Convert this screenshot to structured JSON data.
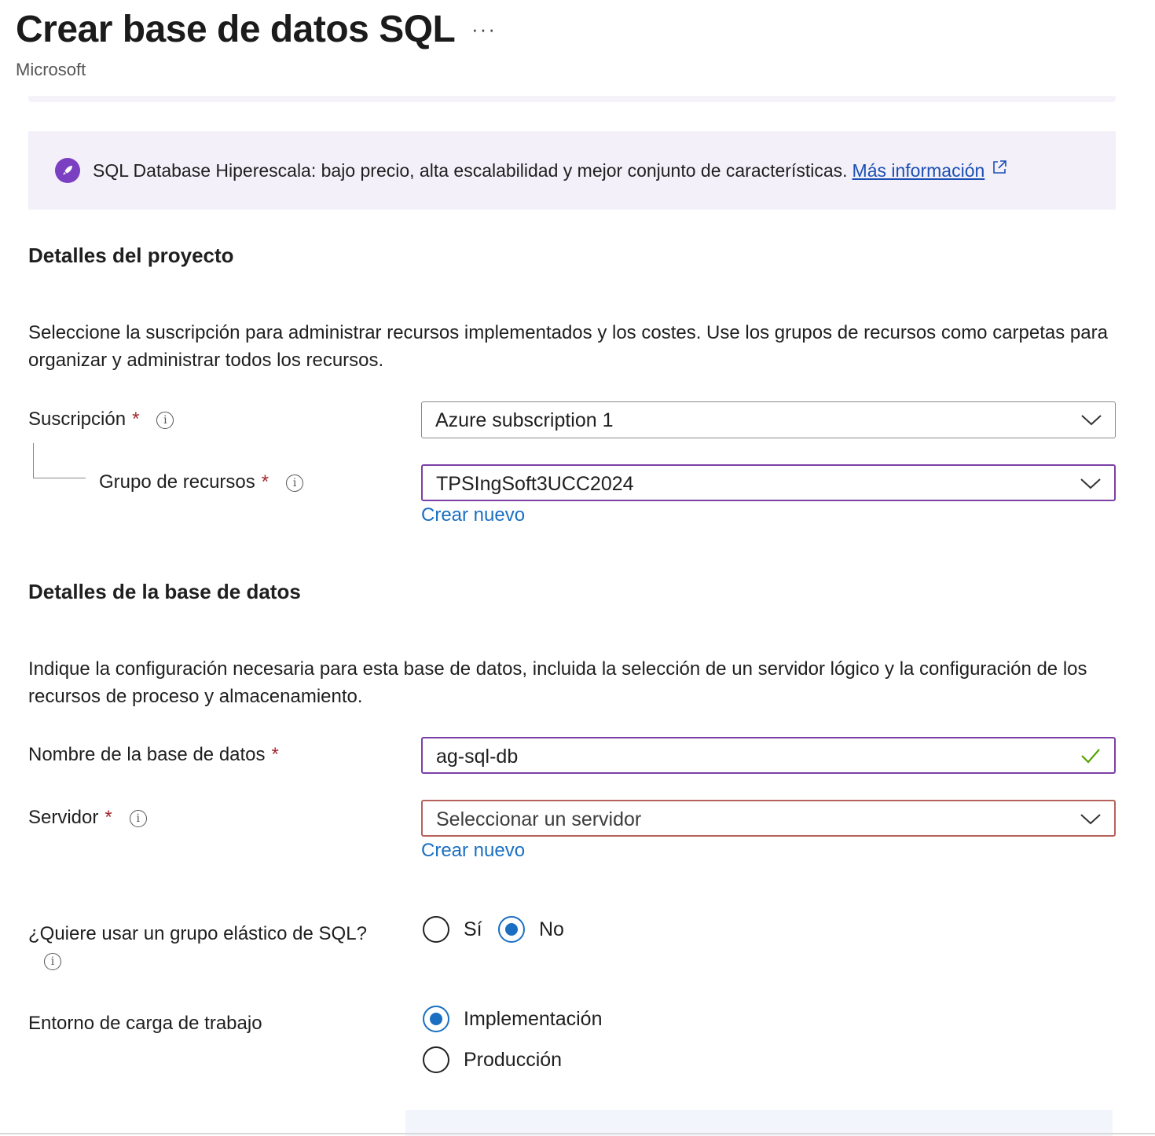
{
  "header": {
    "title": "Crear base de datos SQL",
    "more_label": "···",
    "subtitle": "Microsoft"
  },
  "banner": {
    "icon": "rocket-icon",
    "text": "SQL Database Hiperescala: bajo precio, alta escalabilidad y mejor conjunto de características.",
    "link": "Más información",
    "link_icon": "external-link-icon"
  },
  "project": {
    "heading": "Detalles del proyecto",
    "description": "Seleccione la suscripción para administrar recursos implementados y los costes. Use los grupos de recursos como carpetas para organizar y administrar todos los recursos.",
    "subscription": {
      "label": "Suscripción",
      "required": "*",
      "value": "Azure subscription 1"
    },
    "resource_group": {
      "label": "Grupo de recursos",
      "required": "*",
      "value": "TPSIngSoft3UCC2024",
      "create_link": "Crear nuevo"
    }
  },
  "database": {
    "heading": "Detalles de la base de datos",
    "description": "Indique la configuración necesaria para esta base de datos, incluida la selección de un servidor lógico y la configuración de los recursos de proceso y almacenamiento.",
    "name": {
      "label": "Nombre de la base de datos",
      "required": "*",
      "value": "ag-sql-db"
    },
    "server": {
      "label": "Servidor",
      "required": "*",
      "placeholder": "Seleccionar un servidor",
      "create_link": "Crear nuevo"
    },
    "elastic_pool": {
      "label": "¿Quiere usar un grupo elástico de SQL?",
      "options": [
        "Sí",
        "No"
      ],
      "selected": "No"
    },
    "workload": {
      "label": "Entorno de carga de trabajo",
      "options": [
        "Implementación",
        "Producción"
      ],
      "selected": "Implementación"
    }
  },
  "colors": {
    "accent_purple": "#7b3fa6",
    "link_blue": "#1a6fc2",
    "required_red": "#a4262c",
    "valid_green": "#57a300",
    "error_border": "#b6615c"
  }
}
